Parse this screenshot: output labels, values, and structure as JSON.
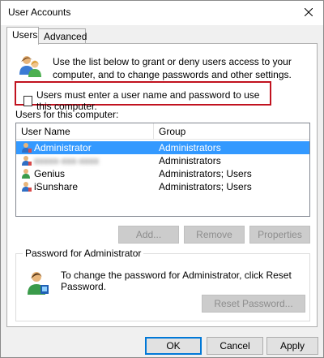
{
  "window": {
    "title": "User Accounts",
    "close_glyph": "✕"
  },
  "tabs": [
    {
      "label": "Users",
      "active": true
    },
    {
      "label": "Advanced",
      "active": false
    }
  ],
  "intro": {
    "icon": "users-icon",
    "text": "Use the list below to grant or deny users access to your computer, and to change passwords and other settings."
  },
  "must_login": {
    "label": "Users must enter a user name and password to use this computer.",
    "checked": false,
    "highlight_color": "#c1121f"
  },
  "users_list": {
    "label": "Users for this computer:",
    "columns": [
      "User Name",
      "Group"
    ],
    "rows": [
      {
        "name": "Administrator",
        "group": "Administrators",
        "selected": true
      },
      {
        "name": "xxxxx-xxx-xxxx",
        "group": "Administrators",
        "selected": false,
        "obscured": true
      },
      {
        "name": "Genius",
        "group": "Administrators; Users",
        "selected": false
      },
      {
        "name": "iSunshare",
        "group": "Administrators; Users",
        "selected": false
      }
    ],
    "selection_color": "#3399ff"
  },
  "list_buttons": {
    "add": "Add...",
    "remove": "Remove",
    "properties": "Properties"
  },
  "password_group": {
    "label": "Password for Administrator",
    "text": "To change the password for Administrator, click Reset Password.",
    "reset_button": "Reset Password..."
  },
  "dialog_buttons": {
    "ok": "OK",
    "cancel": "Cancel",
    "apply": "Apply"
  }
}
